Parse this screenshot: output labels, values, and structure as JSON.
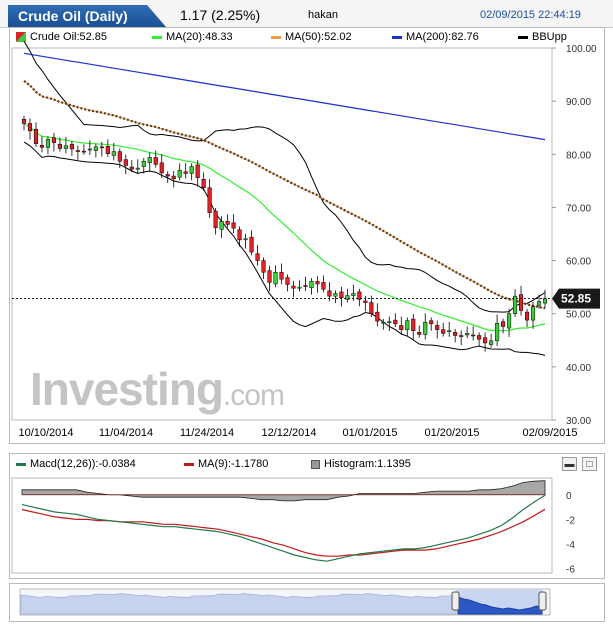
{
  "header": {
    "tab_title": "Crude Oil (Daily)",
    "change": "1.17 (2.25%)",
    "user": "hakan",
    "datetime": "02/09/2015 22:44:19"
  },
  "legend": {
    "price": "Crude Oil:52.85",
    "ma20": "MA(20):48.33",
    "ma50": "MA(50):52.02",
    "ma200": "MA(200):82.76",
    "bb": "BBUpp"
  },
  "colors": {
    "up": "#3ecc3e",
    "down": "#d9242a",
    "ma20": "#33ee33",
    "ma50": "#f09a3e",
    "ma200": "#1f2fd0",
    "bb": "#000000",
    "macd": "#247a48",
    "signal": "#c21a1a"
  },
  "macd_legend": {
    "macd": "Macd(12,26)):-0.0384",
    "signal": "MA(9):-1.1780",
    "hist": "Histogram:1.1395"
  },
  "current_price_label": "52.85",
  "chart_data": [
    {
      "type": "candlestick",
      "y_ticks": [
        "100.00",
        "90.00",
        "80.00",
        "70.00",
        "60.00",
        "50.00",
        "40.00",
        "30.00"
      ],
      "ylim": [
        30,
        100
      ],
      "x_ticks": [
        "10/10/2014",
        "11/04/2014",
        "11/24/2014",
        "12/12/2014",
        "01/01/2015",
        "01/20/2015",
        "02/09/2015"
      ],
      "close": [
        85.8,
        84.4,
        82.0,
        81.3,
        82.8,
        82.2,
        81.1,
        81.6,
        81.0,
        80.6,
        80.5,
        81.0,
        81.4,
        81.2,
        80.1,
        80.5,
        78.7,
        77.9,
        77.2,
        77.4,
        78.7,
        79.4,
        78.1,
        76.5,
        75.9,
        75.4,
        77.0,
        76.4,
        77.7,
        75.6,
        73.7,
        69.0,
        66.2,
        67.4,
        66.8,
        66.1,
        63.9,
        64.1,
        61.6,
        60.0,
        57.8,
        55.9,
        57.8,
        56.5,
        55.5,
        54.8,
        55.0,
        55.2,
        56.1,
        55.6,
        54.6,
        53.3,
        53.8,
        53.0,
        53.4,
        53.8,
        52.7,
        52.1,
        50.0,
        48.6,
        48.4,
        48.5,
        48.1,
        47.0,
        48.7,
        46.8,
        46.1,
        48.4,
        48.1,
        47.0,
        46.3,
        46.8,
        45.9,
        45.7,
        46.3,
        45.9,
        45.2,
        44.5,
        44.9,
        48.2,
        47.6,
        50.0,
        53.3,
        50.6,
        48.8,
        51.3,
        52.3,
        52.85
      ]
    },
    {
      "type": "line",
      "series": [
        {
          "name": "Macd(12,26))",
          "values": [
            -0.8,
            -1.0,
            -1.2,
            -1.4,
            -1.5,
            -1.6,
            -1.8,
            -2.0,
            -2.1,
            -2.2,
            -2.3,
            -2.4,
            -2.5,
            -2.6,
            -2.6,
            -2.7,
            -2.8,
            -2.9,
            -3.0,
            -3.2,
            -3.4,
            -3.7,
            -4.0,
            -4.3,
            -4.6,
            -4.9,
            -5.1,
            -5.3,
            -5.4,
            -5.2,
            -5.0,
            -4.8,
            -4.7,
            -4.6,
            -4.5,
            -4.4,
            -4.4,
            -4.3,
            -4.1,
            -3.9,
            -3.7,
            -3.5,
            -3.2,
            -2.9,
            -2.5,
            -1.9,
            -1.2,
            -0.6,
            -0.04
          ]
        },
        {
          "name": "MA(9)",
          "values": [
            -1.2,
            -1.4,
            -1.6,
            -1.8,
            -1.9,
            -2.0,
            -2.0,
            -2.1,
            -2.1,
            -2.2,
            -2.2,
            -2.2,
            -2.3,
            -2.4,
            -2.4,
            -2.5,
            -2.6,
            -2.7,
            -2.8,
            -3.0,
            -3.2,
            -3.4,
            -3.6,
            -3.9,
            -4.1,
            -4.4,
            -4.7,
            -4.9,
            -5.0,
            -5.0,
            -4.9,
            -4.9,
            -4.8,
            -4.7,
            -4.6,
            -4.5,
            -4.5,
            -4.5,
            -4.4,
            -4.2,
            -4.0,
            -3.8,
            -3.6,
            -3.3,
            -3.0,
            -2.6,
            -2.2,
            -1.7,
            -1.18
          ]
        }
      ],
      "y_ticks": [
        "0",
        "-2",
        "-4",
        "-6"
      ],
      "ylim": [
        -6.2,
        1.2
      ]
    }
  ]
}
